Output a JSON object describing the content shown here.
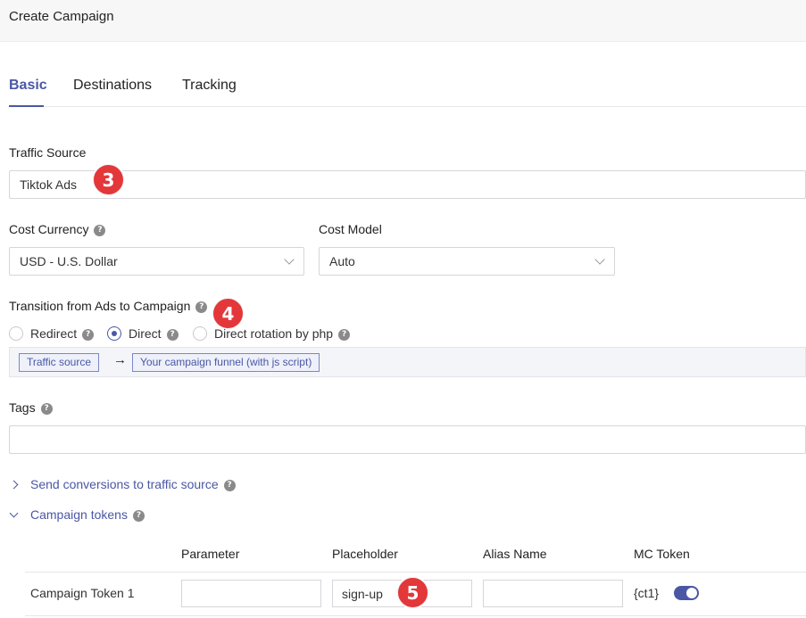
{
  "header": {
    "title": "Create Campaign"
  },
  "tabs": [
    {
      "label": "Basic",
      "active": true
    },
    {
      "label": "Destinations",
      "active": false
    },
    {
      "label": "Tracking",
      "active": false
    }
  ],
  "traffic_source": {
    "label": "Traffic Source",
    "value": "Tiktok Ads"
  },
  "cost_currency": {
    "label": "Cost Currency",
    "value": "USD - U.S. Dollar"
  },
  "cost_model": {
    "label": "Cost Model",
    "value": "Auto"
  },
  "transition": {
    "label": "Transition from Ads to Campaign",
    "options": [
      {
        "label": "Redirect",
        "checked": false
      },
      {
        "label": "Direct",
        "checked": true
      },
      {
        "label": "Direct rotation by php",
        "checked": false
      }
    ],
    "flow": {
      "source": "Traffic source",
      "target": "Your campaign funnel (with js script)"
    }
  },
  "tags": {
    "label": "Tags",
    "value": ""
  },
  "sections": {
    "send_conversions": {
      "label": "Send conversions to traffic source",
      "expanded": false
    },
    "campaign_tokens": {
      "label": "Campaign tokens",
      "expanded": true
    }
  },
  "tokens_table": {
    "columns": [
      "Parameter",
      "Placeholder",
      "Alias Name",
      "MC Token"
    ],
    "rows": [
      {
        "label": "Campaign Token 1",
        "parameter": "",
        "placeholder": "sign-up",
        "alias": "",
        "mc_token": "{ct1}",
        "enabled": true
      }
    ]
  },
  "annotations": [
    "3",
    "4",
    "5"
  ],
  "colors": {
    "accent": "#4a57a4",
    "badge": "#e3373a"
  },
  "icons": {
    "help": "question-circle-icon",
    "dropdown": "chevron-down-icon",
    "arrow": "arrow-right-icon"
  }
}
